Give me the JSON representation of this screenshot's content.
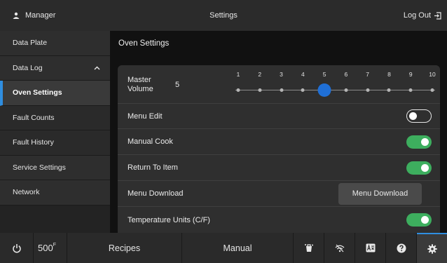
{
  "header": {
    "user": "Manager",
    "title": "Settings",
    "logout": "Log Out"
  },
  "sidebar": {
    "items": [
      {
        "label": "Data Plate"
      },
      {
        "label": "Data Log"
      },
      {
        "label": "Oven Settings"
      },
      {
        "label": "Fault Counts"
      },
      {
        "label": "Fault History"
      },
      {
        "label": "Service Settings"
      },
      {
        "label": "Network"
      }
    ]
  },
  "main": {
    "title": "Oven Settings",
    "volume": {
      "label_line1": "Master",
      "label_line2": "Volume",
      "value": "5",
      "ticks": [
        "1",
        "2",
        "3",
        "4",
        "5",
        "6",
        "7",
        "8",
        "9",
        "10"
      ],
      "selected": 5
    },
    "rows": [
      {
        "label": "Menu Edit",
        "control": "toggle",
        "state": "off"
      },
      {
        "label": "Manual Cook",
        "control": "toggle",
        "state": "on"
      },
      {
        "label": "Return To Item",
        "control": "toggle",
        "state": "on"
      },
      {
        "label": "Menu Download",
        "control": "button",
        "button_label": "Menu Download"
      },
      {
        "label": "Temperature Units (C/F)",
        "control": "toggle",
        "state": "on"
      }
    ]
  },
  "bottom": {
    "temperature": "500",
    "temperature_unit": "F",
    "recipes": "Recipes",
    "manual": "Manual"
  },
  "colors": {
    "accent": "#2f8ee0",
    "toggle_on": "#3dae5e",
    "slider_thumb": "#1f6fd6"
  }
}
